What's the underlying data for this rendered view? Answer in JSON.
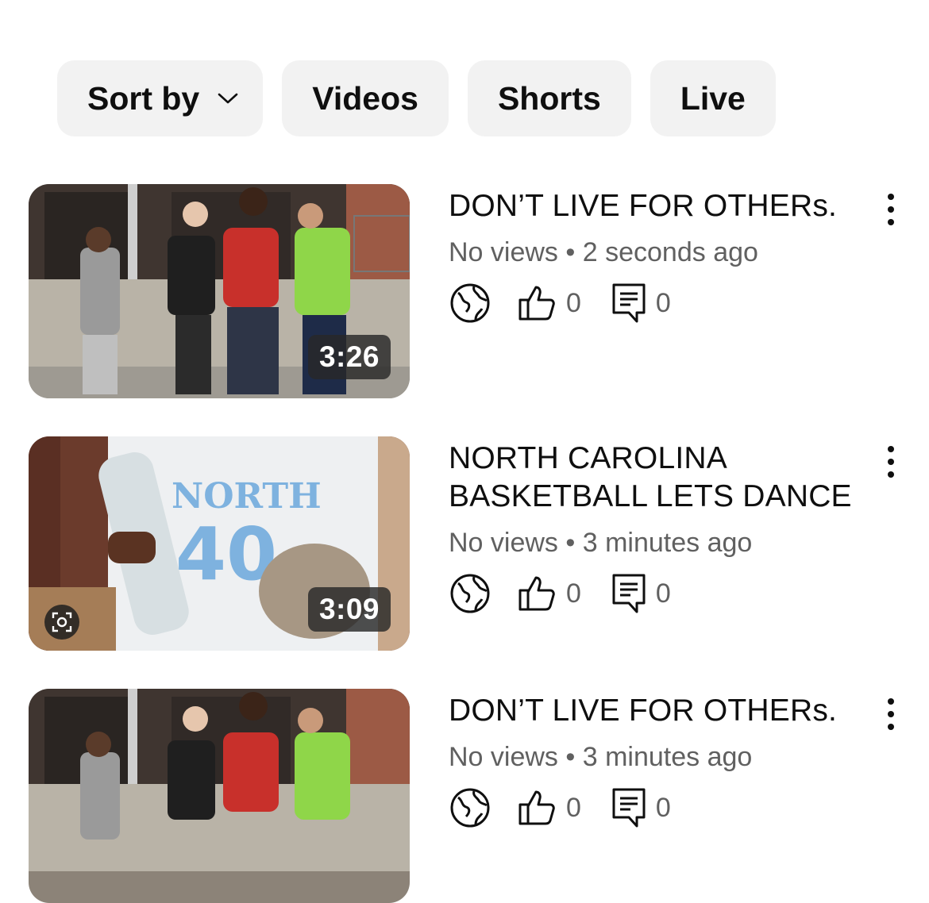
{
  "filters": {
    "sort_label": "Sort by",
    "chips": [
      "Videos",
      "Shorts",
      "Live"
    ]
  },
  "videos": [
    {
      "title": "DON’T LIVE FOR OTHERs.",
      "views": "No views",
      "separator": "•",
      "time": "2 seconds ago",
      "duration": "3:26",
      "likes": "0",
      "comments": "0",
      "visibility_icon": "globe-icon"
    },
    {
      "title": "NORTH CAROLINA BASKETBALL LETS DANCE",
      "views": "No views",
      "separator": "•",
      "time": "3 minutes ago",
      "duration": "3:09",
      "likes": "0",
      "comments": "0",
      "visibility_icon": "globe-icon"
    },
    {
      "title": "DON’T LIVE FOR OTHERs.",
      "views": "No views",
      "separator": "•",
      "time": "3 minutes ago",
      "duration": "",
      "likes": "0",
      "comments": "0",
      "visibility_icon": "globe-icon"
    }
  ]
}
